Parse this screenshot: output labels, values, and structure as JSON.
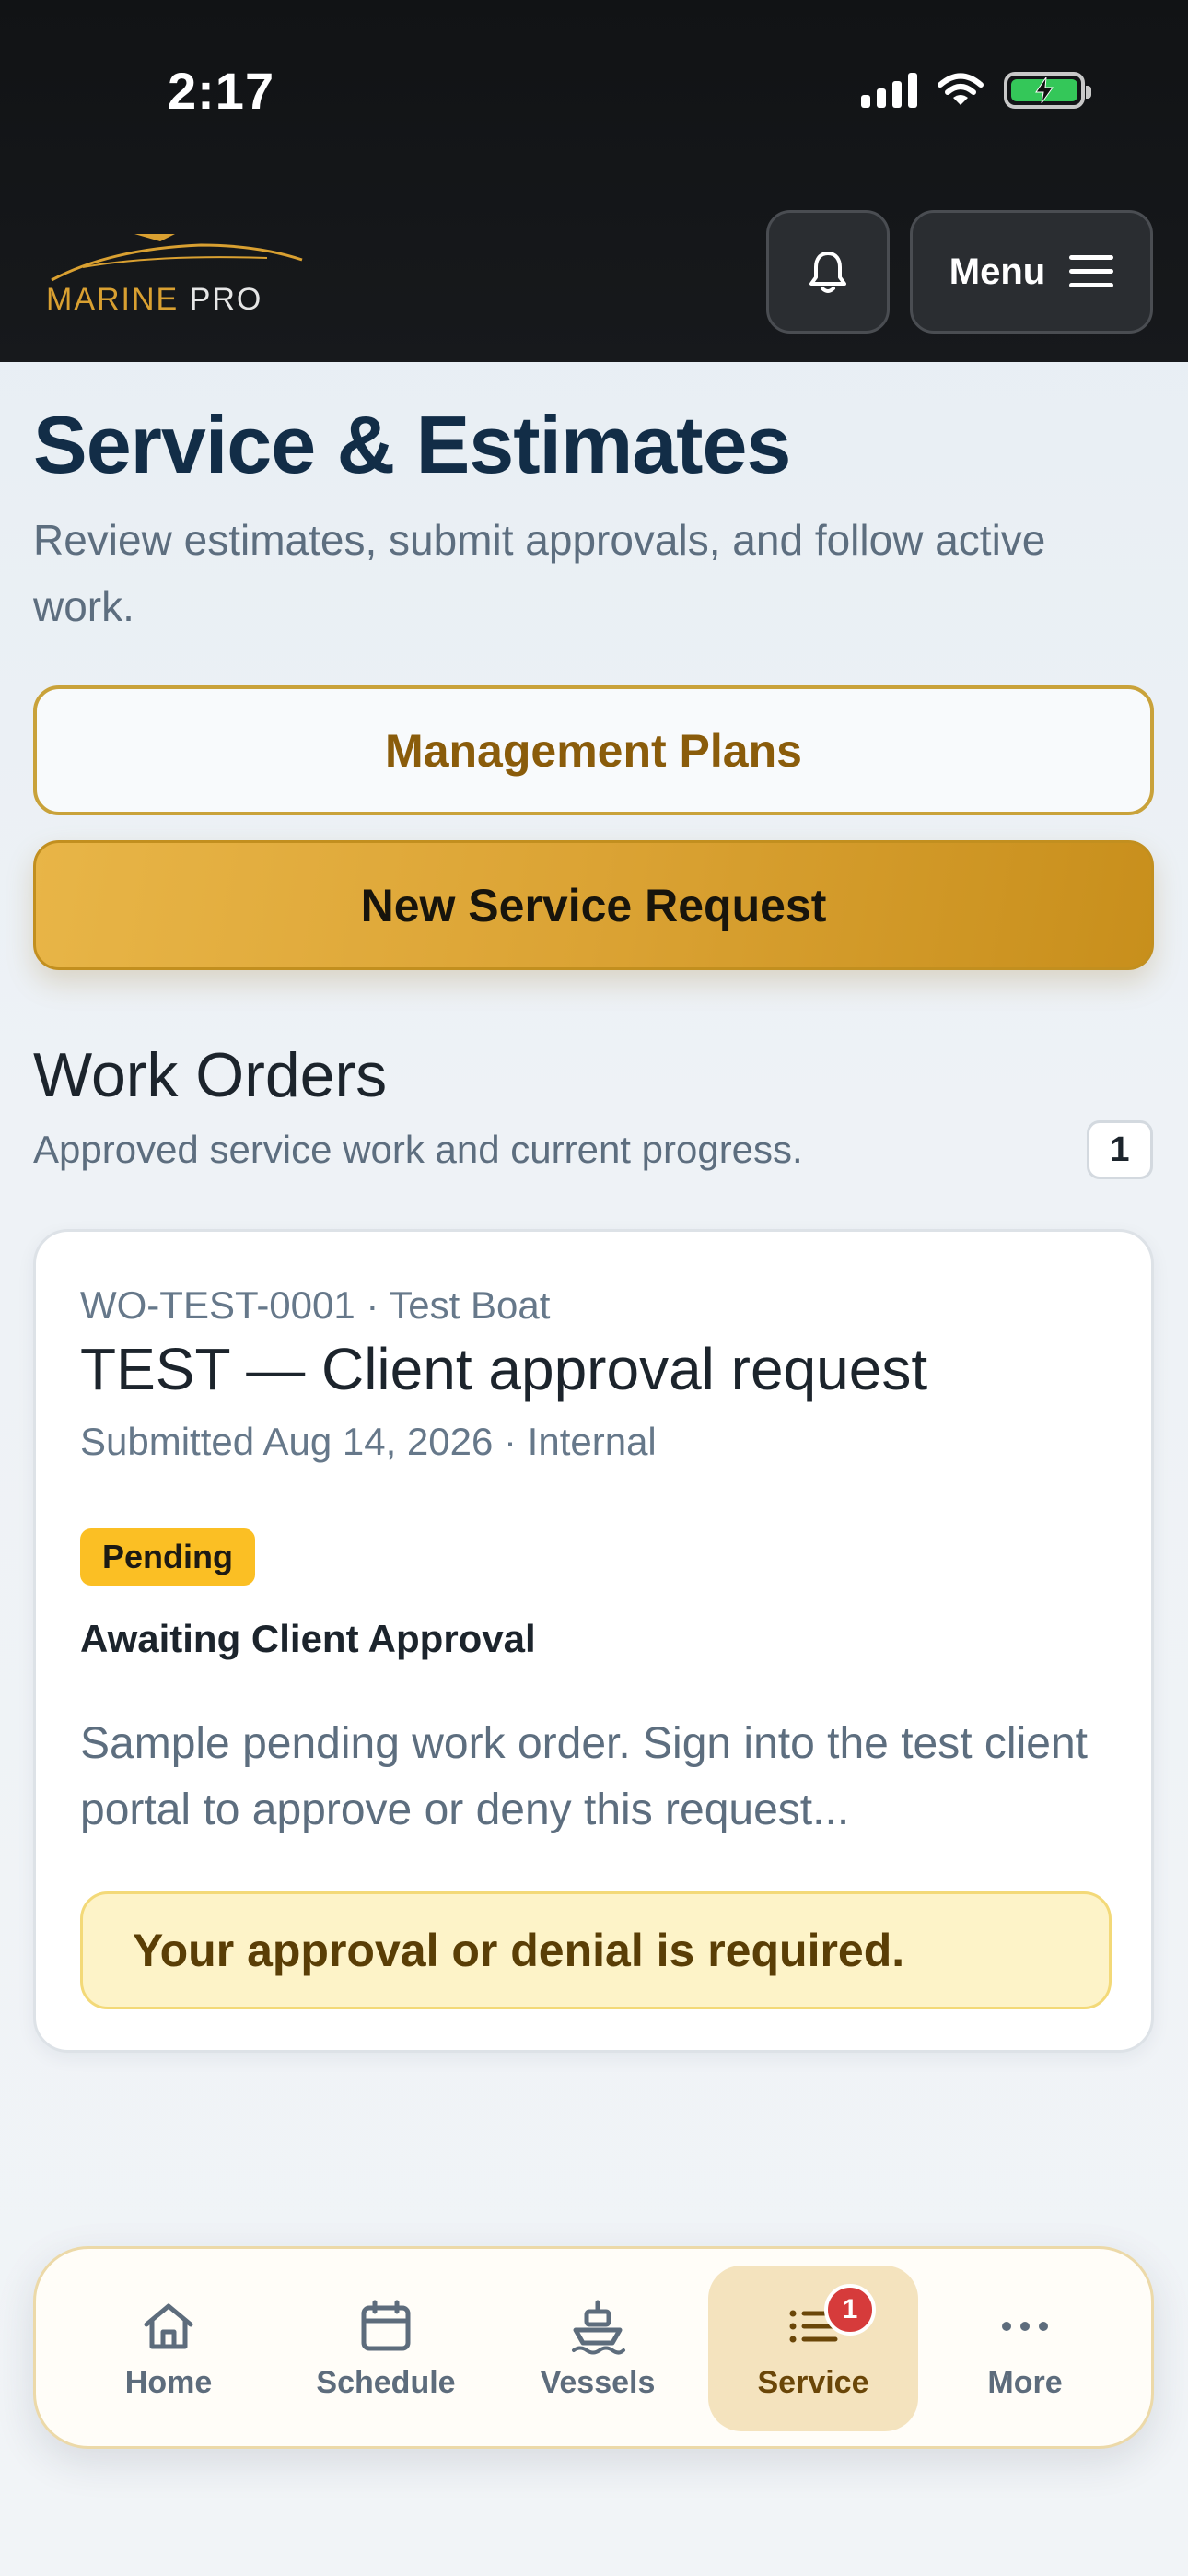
{
  "status_bar": {
    "time": "2:17"
  },
  "header": {
    "logo_part1": "MARINE",
    "logo_part2": "PRO",
    "menu_label": "Menu",
    "icons": [
      "bell-icon",
      "hamburger-icon"
    ]
  },
  "page": {
    "title": "Service & Estimates",
    "subtitle": "Review estimates, submit approvals, and follow active work."
  },
  "actions": {
    "management_plans_label": "Management Plans",
    "new_request_label": "New Service Request"
  },
  "work_orders": {
    "title": "Work Orders",
    "subtitle": "Approved service work and current progress.",
    "count": "1",
    "items": [
      {
        "meta": "WO-TEST-0001 · Test Boat",
        "title": "TEST — Client approval request",
        "submitted": "Submitted Aug 14, 2026 · Internal",
        "badge": "Pending",
        "status": "Awaiting Client Approval",
        "description": "Sample pending work order. Sign into the test client portal to approve or deny this request...",
        "notice": "Your approval or denial is required."
      }
    ]
  },
  "bottom_nav": {
    "items": [
      {
        "label": "Home",
        "icon": "home-icon"
      },
      {
        "label": "Schedule",
        "icon": "calendar-icon"
      },
      {
        "label": "Vessels",
        "icon": "boat-icon"
      },
      {
        "label": "Service",
        "icon": "list-icon",
        "badge": "1",
        "active": true
      },
      {
        "label": "More",
        "icon": "more-icon"
      }
    ]
  },
  "colors": {
    "accent": "#d9a031",
    "navy": "#122d47",
    "pending": "#fbbf24",
    "nav_badge": "#d63b3b"
  }
}
